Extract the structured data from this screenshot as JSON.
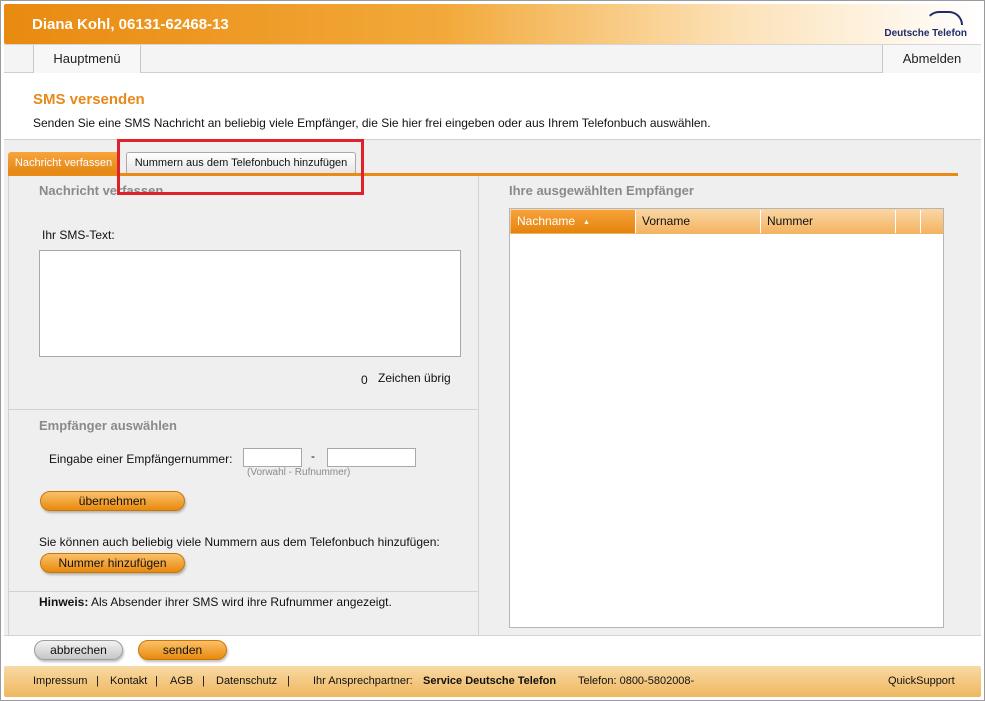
{
  "header": {
    "title": "Diana Kohl, 06131-62468-13",
    "logo_text": "Deutsche Telefon"
  },
  "nav": {
    "main_menu": "Hauptmenü",
    "logout": "Abmelden"
  },
  "page": {
    "title": "SMS versenden",
    "description": "Senden Sie eine SMS Nachricht an beliebig viele Empfänger, die Sie hier frei eingeben oder aus Ihrem Telefonbuch auswählen."
  },
  "tabs": [
    {
      "label": "Nachricht verfassen",
      "active": true
    },
    {
      "label": "Nummern aus dem Telefonbuch hinzufügen",
      "active": false
    }
  ],
  "compose": {
    "heading": "Nachricht verfassen",
    "sms_label": "Ihr SMS-Text:",
    "sms_value": "",
    "chars_count": "0",
    "chars_label": "Zeichen übrig"
  },
  "recipient": {
    "heading": "Empfänger auswählen",
    "input_label": "Eingabe einer Empfängernummer:",
    "dash": "-",
    "hint": "(Vorwahl - Rufnummer)",
    "apply_button": "übernehmen",
    "phonebook_text": "Sie können auch beliebig viele Nummern aus dem Telefonbuch hinzufügen:",
    "add_button": "Nummer hinzufügen"
  },
  "note": {
    "label": "Hinweis:",
    "text": "Als Absender ihrer SMS wird ihre Rufnummer angezeigt."
  },
  "selected": {
    "heading": "Ihre ausgewählten Empfänger",
    "columns": [
      "Nachname",
      "Vorname",
      "Nummer"
    ],
    "sort_arrow": "▲",
    "rows": []
  },
  "actions": {
    "cancel": "abbrechen",
    "send": "senden"
  },
  "footer": {
    "links": [
      "Impressum",
      "Kontakt",
      "AGB",
      "Datenschutz"
    ],
    "separator": "|",
    "contact_label": "Ihr Ansprechpartner:",
    "contact_name": "Service Deutsche Telefon",
    "phone": "Telefon: 0800-5802008-",
    "quicksupport": "QuickSupport"
  },
  "colors": {
    "accent": "#e8891a",
    "highlight": "#e0202a",
    "heading_grey": "#8a8a8a"
  }
}
